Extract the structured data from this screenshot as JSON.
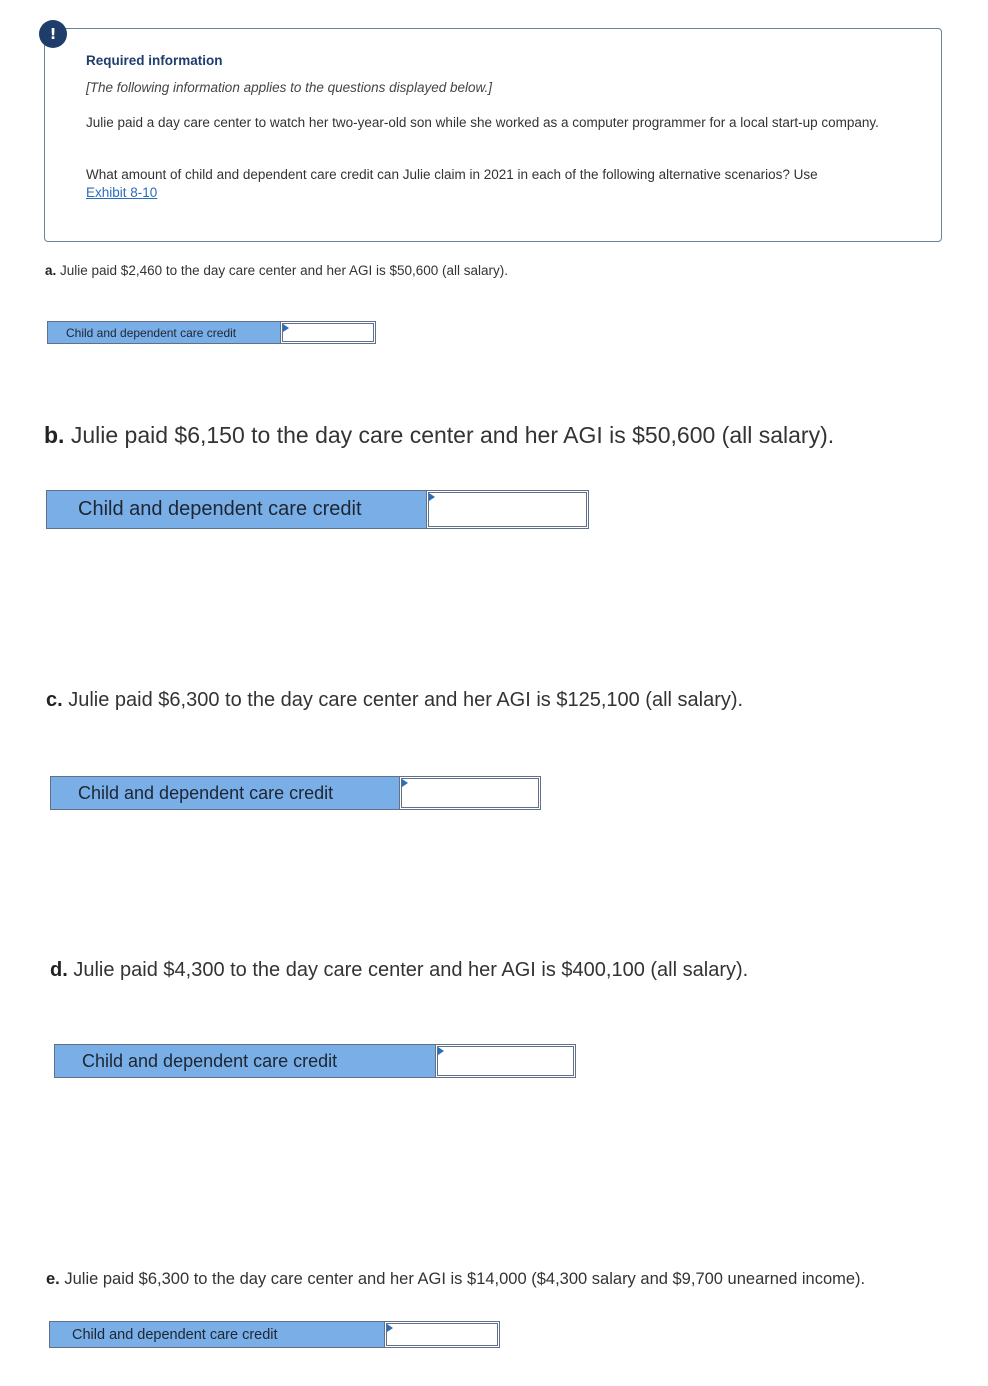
{
  "info": {
    "badge": "!",
    "title": "Required information",
    "subtitle": "[The following information applies to the questions displayed below.]",
    "paragraph1": "Julie paid a day care center to watch her two-year-old son while she worked as a computer programmer for a local start-up company.",
    "paragraph2_text": "What amount of child and dependent care credit can Julie claim in 2021 in each of the following alternative scenarios? Use ",
    "paragraph2_link": "Exhibit 8-10"
  },
  "questions": [
    {
      "letter": "a.",
      "text": " Julie paid $2,460 to the day care center and her AGI is $50,600 (all salary).",
      "row_label": "Child and dependent care credit",
      "value": ""
    },
    {
      "letter": "b.",
      "text": " Julie paid $6,150 to the day care center and her AGI is $50,600 (all salary).",
      "row_label": "Child and dependent care credit",
      "value": ""
    },
    {
      "letter": "c.",
      "text": " Julie paid $6,300 to the day care center and her AGI is $125,100 (all salary).",
      "row_label": "Child and dependent care credit",
      "value": ""
    },
    {
      "letter": "d.",
      "text": " Julie paid $4,300 to the day care center and her AGI is $400,100 (all salary).",
      "row_label": "Child and dependent care credit",
      "value": ""
    },
    {
      "letter": "e.",
      "text": " Julie paid $6,300 to the day care center and her AGI is $14,000 ($4,300 salary and $9,700 unearned income).",
      "row_label": "Child and dependent care credit",
      "value": ""
    }
  ]
}
